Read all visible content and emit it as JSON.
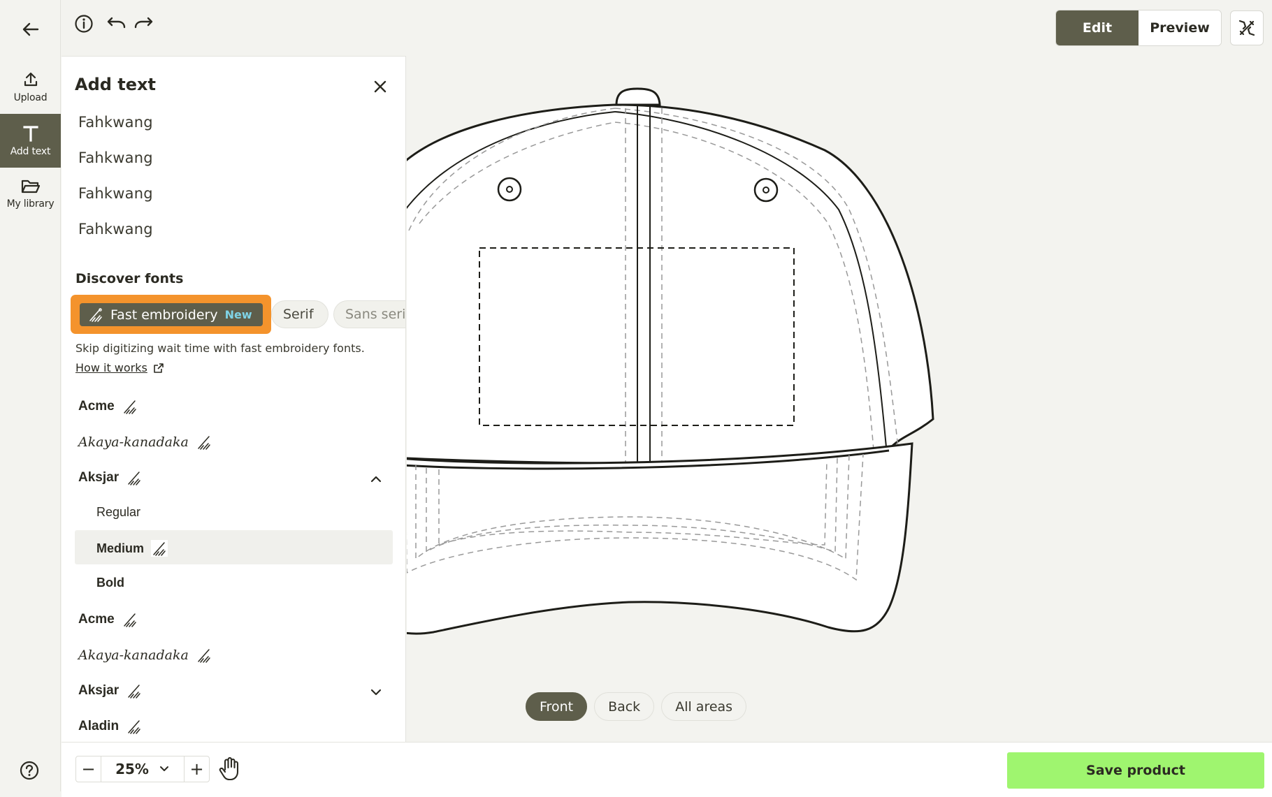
{
  "nav": {
    "upload_label": "Upload",
    "addtext_label": "Add text",
    "library_label": "My library"
  },
  "topbar": {
    "edit_label": "Edit",
    "preview_label": "Preview"
  },
  "panel": {
    "title": "Add text",
    "samples": [
      "Fahkwang",
      "Fahkwang",
      "Fahkwang",
      "Fahkwang"
    ],
    "discover_title": "Discover fonts",
    "chips": {
      "fast_label": "Fast embroidery",
      "fast_badge": "New",
      "serif_label": "Serif",
      "sans_label": "Sans serif"
    },
    "description": "Skip digitizing wait time with fast embroidery fonts.",
    "how_link": "How it works",
    "fonts": [
      {
        "name": "Acme"
      },
      {
        "name": "Akaya-kanadaka"
      },
      {
        "name": "Aksjar"
      },
      {
        "name": "Acme"
      },
      {
        "name": "Akaya-kanadaka"
      },
      {
        "name": "Aksjar"
      },
      {
        "name": "Aladin"
      }
    ],
    "weights": [
      "Regular",
      "Medium",
      "Bold"
    ]
  },
  "views": {
    "front": "Front",
    "back": "Back",
    "all": "All areas",
    "active": "Front"
  },
  "zoom": {
    "value": "25%",
    "minus": "−",
    "plus": "+"
  },
  "save_label": "Save product",
  "colors": {
    "accent": "#5e5e4b",
    "highlight": "#f4932c",
    "save": "#9ff56f",
    "new_badge": "#7fd3e6"
  }
}
